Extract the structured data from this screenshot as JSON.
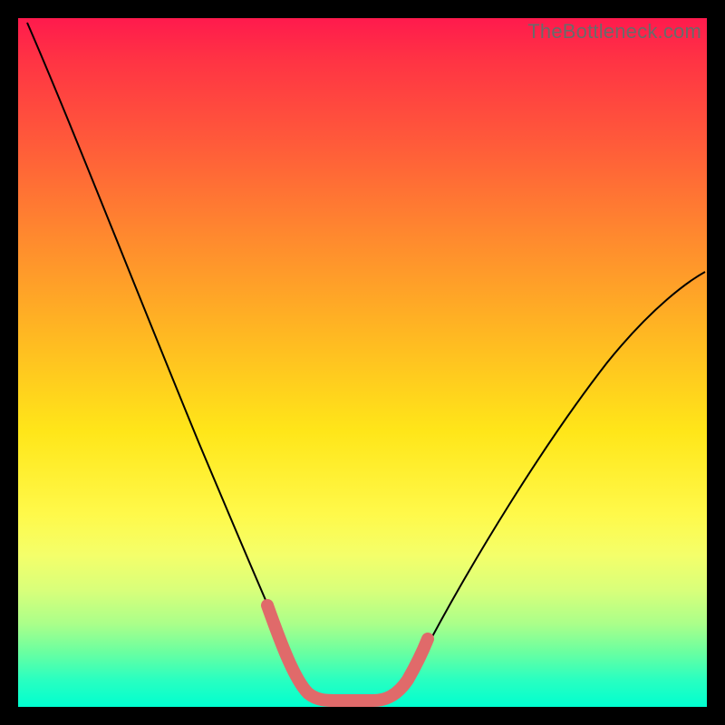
{
  "watermark": "TheBottleneck.com",
  "chart_data": {
    "type": "line",
    "title": "",
    "xlabel": "",
    "ylabel": "",
    "xlim": [
      0,
      100
    ],
    "ylim": [
      0,
      100
    ],
    "grid": false,
    "legend": false,
    "background_gradient": {
      "top": "#ff1a4d",
      "mid": "#ffe619",
      "bottom": "#00ffd0"
    },
    "series": [
      {
        "name": "bottleneck-curve",
        "color": "#000000",
        "stroke_width": 2,
        "x": [
          0,
          5,
          10,
          15,
          20,
          25,
          30,
          35,
          38,
          40,
          42,
          45,
          48,
          50,
          55,
          60,
          65,
          70,
          75,
          80,
          85,
          90,
          95,
          100
        ],
        "y": [
          100,
          90,
          80,
          70,
          60,
          50,
          40,
          28,
          18,
          10,
          5,
          2,
          1,
          1,
          2,
          6,
          12,
          20,
          28,
          36,
          44,
          51,
          57,
          63
        ]
      },
      {
        "name": "optimal-range-marker",
        "color": "#e06a6a",
        "stroke_width": 12,
        "stroke_linecap": "round",
        "x": [
          35,
          38,
          40,
          42,
          45,
          48,
          50,
          53,
          55
        ],
        "y": [
          28,
          18,
          10,
          5,
          2,
          1,
          1,
          4,
          10
        ]
      }
    ],
    "annotations": []
  }
}
